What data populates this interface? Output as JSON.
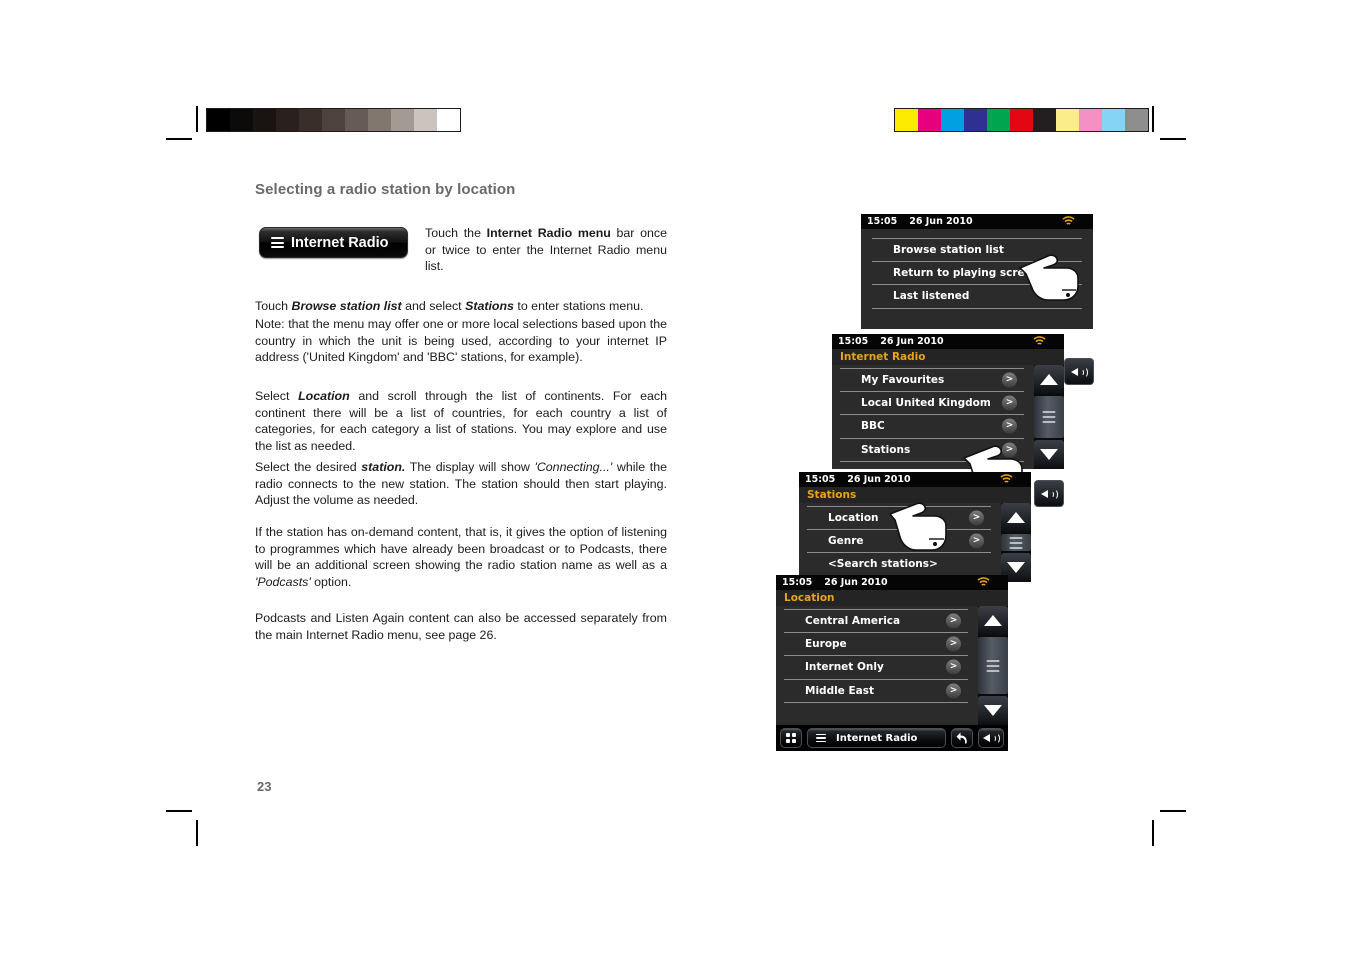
{
  "page": {
    "heading": "Selecting a radio station by location",
    "folio": "23"
  },
  "calibration": {
    "grey_swatches": [
      "#000000",
      "#0d0a0a",
      "#191312",
      "#2a201e",
      "#3a2e2b",
      "#4e423e",
      "#665b56",
      "#82776f",
      "#a39a93",
      "#cbc3bd",
      "#ffffff"
    ],
    "color_swatches": [
      "#fcea00",
      "#e6007e",
      "#00a0e3",
      "#2e3192",
      "#00a550",
      "#e30613",
      "#231f20",
      "#fbee8a",
      "#f391c5",
      "#85d3f5",
      "#8d8d8d"
    ]
  },
  "sample_bar": {
    "label": "Internet Radio",
    "icon": "hamburger-menu-icon"
  },
  "paragraphs": {
    "side_note": {
      "pre": "Touch the ",
      "bold1": "Internet Radio menu",
      "post": " bar once or twice to enter the Internet Radio menu list."
    },
    "p1": {
      "pre": "Touch ",
      "bold1": "Browse station list",
      "mid": " and select ",
      "bold2": "Stations",
      "post": " to enter stations menu."
    },
    "p2": "Note: that the menu may offer one or more local selections based upon the country in which the unit is being used, according to your internet IP address ('United Kingdom' and 'BBC' stations, for example).",
    "p3": {
      "pre": "Select ",
      "bold1": "Location",
      "post": " and scroll through the list of continents. For each continent there will be a list of countries, for each country a list of categories, for each category a list of stations. You may explore and use the list as needed."
    },
    "p4": {
      "pre": "Select the desired ",
      "bold1": "station.",
      "mid": " The display will show ",
      "italic1": "'Connecting...'",
      "post": " while the radio connects to the new station. The station should then start playing. Adjust the volume as needed."
    },
    "p5": {
      "pre": "If the station has on-demand content, that is, it gives the option of listening to programmes which have already been broadcast or to Podcasts, there will be an additional screen showing the radio station name as well as a ",
      "italic1": "'Podcasts'",
      "post": " option."
    },
    "p6": "Podcasts and Listen Again content can also be accessed separately from the main Internet Radio menu, see page 26."
  },
  "devices": {
    "screen1": {
      "status": {
        "time": "15:05",
        "date": "26 Jun 2010",
        "wifi_icon": "wifi-icon"
      },
      "rows": [
        {
          "label": "Browse station list"
        },
        {
          "label": "Return to playing screen"
        },
        {
          "label": "Last listened"
        }
      ]
    },
    "screen2": {
      "status": {
        "time": "15:05",
        "date": "26 Jun 2010",
        "wifi_icon": "wifi-icon"
      },
      "title": "Internet Radio",
      "rows": [
        {
          "label": "My Favourites",
          "chevron": ">"
        },
        {
          "label": "Local United Kingdom",
          "chevron": ">"
        },
        {
          "label": "BBC",
          "chevron": ">"
        },
        {
          "label": "Stations",
          "chevron": ">"
        }
      ],
      "volume_icon": "speaker-volume-icon"
    },
    "screen3": {
      "status": {
        "time": "15:05",
        "date": "26 Jun 2010",
        "wifi_icon": "wifi-icon"
      },
      "title": "Stations",
      "rows": [
        {
          "label": "Location",
          "chevron": ">"
        },
        {
          "label": "Genre",
          "chevron": ">"
        },
        {
          "label": "<Search stations>",
          "chevron": ""
        }
      ],
      "volume_icon": "speaker-volume-icon"
    },
    "screen4": {
      "status": {
        "time": "15:05",
        "date": "26 Jun 2010",
        "wifi_icon": "wifi-icon"
      },
      "title": "Location",
      "rows": [
        {
          "label": "Central America",
          "chevron": ">"
        },
        {
          "label": "Europe",
          "chevron": ">"
        },
        {
          "label": "Internet Only",
          "chevron": ">"
        },
        {
          "label": "Middle East",
          "chevron": ">"
        }
      ],
      "toolbar": {
        "grid_icon": "grid-mode-icon",
        "menu_label": "Internet Radio",
        "menu_icon": "hamburger-menu-icon",
        "back_icon": "back-arrow-icon",
        "volume_icon": "speaker-volume-icon"
      }
    }
  },
  "colors": {
    "accent_title": "#e8a317",
    "screen_bg": "#2b2b2b",
    "statusbar_bg": "#050505",
    "heading_grey": "#6a6a6a"
  }
}
